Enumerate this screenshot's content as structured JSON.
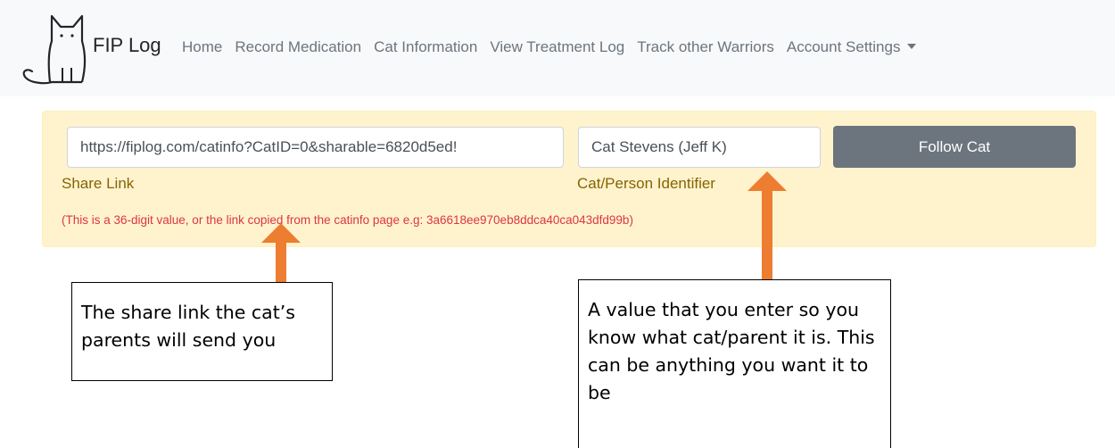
{
  "navbar": {
    "brand": "FIP Log",
    "links": [
      {
        "label": "Home"
      },
      {
        "label": "Record Medication"
      },
      {
        "label": "Cat Information"
      },
      {
        "label": "View Treatment Log"
      },
      {
        "label": "Track other Warriors"
      },
      {
        "label": "Account Settings"
      }
    ]
  },
  "form": {
    "share_link_value": "https://fiplog.com/catinfo?CatID=0&sharable=6820d5ed!",
    "share_link_label": "Share Link",
    "identifier_value": "Cat Stevens (Jeff K)",
    "identifier_label": "Cat/Person Identifier",
    "follow_button": "Follow Cat",
    "hint": "(This is a 36-digit value, or the link copied from the catinfo page e.g: 3a6618ee970eb8ddca40ca043dfd99b)"
  },
  "callouts": {
    "left_line1": "The share link the cat’s",
    "left_line2": "parents will send you",
    "right_line1": "A value that you enter so you",
    "right_line2": "know what cat/parent it is.  This",
    "right_line3": "can be anything you want it to be"
  },
  "colors": {
    "arrow": "#ed7d31",
    "panel": "#fff3cd",
    "label": "#856404",
    "hint": "#dc3545",
    "button": "#6c757d"
  }
}
